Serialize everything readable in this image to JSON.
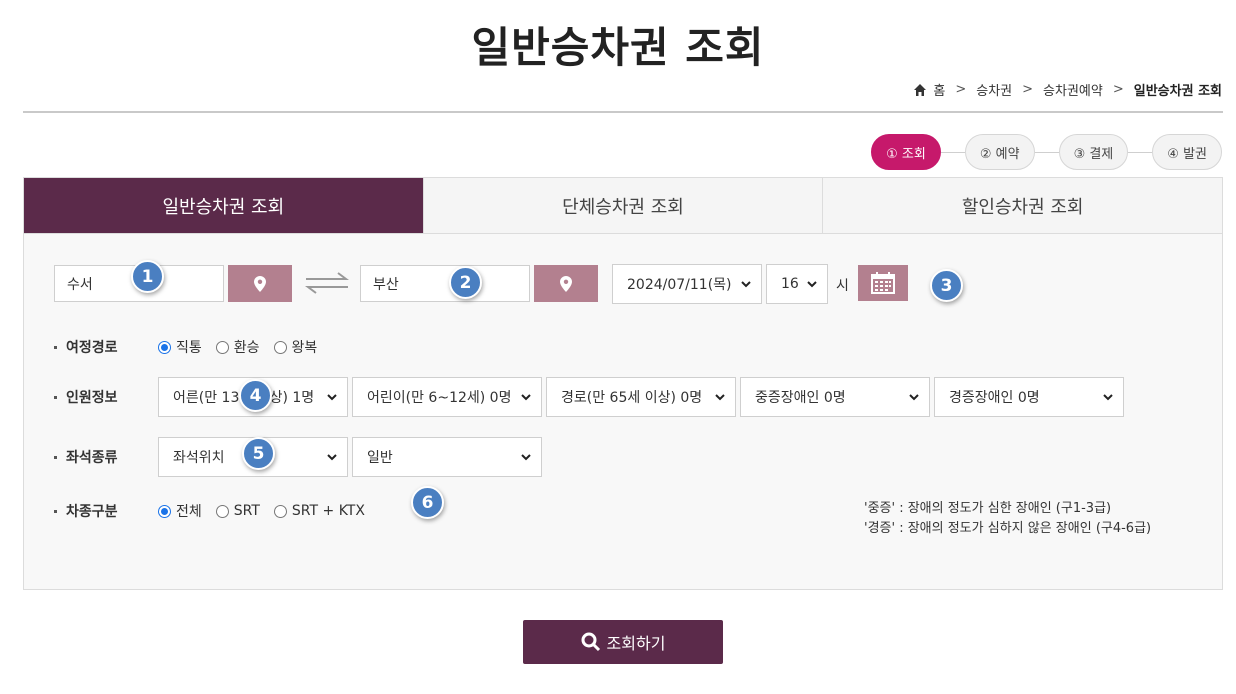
{
  "page_title": "일반승차권 조회",
  "breadcrumb": {
    "home": "홈",
    "items": [
      "승차권",
      "승차권예약"
    ],
    "current": "일반승차권 조회"
  },
  "steps": [
    "① 조회",
    "② 예약",
    "③ 결제",
    "④ 발권"
  ],
  "tabs": [
    "일반승차권 조회",
    "단체승차권 조회",
    "할인승차권 조회"
  ],
  "search": {
    "departure": "수서",
    "arrival": "부산",
    "date": "2024/07/11(목)",
    "hour": "16",
    "hour_unit": "시"
  },
  "journey": {
    "label": "여정경로",
    "options": [
      "직통",
      "환승",
      "왕복"
    ],
    "selected": "직통"
  },
  "passengers": {
    "label": "인원정보",
    "adult": "어른(만 13세 이상) 1명",
    "child": "어린이(만 6~12세) 0명",
    "senior": "경로(만 65세 이상) 0명",
    "severe_disabled": "중증장애인 0명",
    "mild_disabled": "경증장애인 0명"
  },
  "seat": {
    "label": "좌석종류",
    "position": "좌석위치",
    "class": "일반"
  },
  "train_type": {
    "label": "차종구분",
    "options": [
      "전체",
      "SRT",
      "SRT + KTX"
    ],
    "selected": "전체"
  },
  "notes": [
    "'중증' : 장애의 정도가 심한 장애인 (구1-3급)",
    "'경증' : 장애의 정도가 심하지 않은 장애인 (구4-6급)"
  ],
  "badges": [
    "1",
    "2",
    "3",
    "4",
    "5",
    "6"
  ],
  "submit_label": "조회하기",
  "colors": {
    "accent": "#5b2a4a",
    "step_active": "#c6196b",
    "location_button": "#b3808f",
    "badge": "#4a7fc1"
  }
}
